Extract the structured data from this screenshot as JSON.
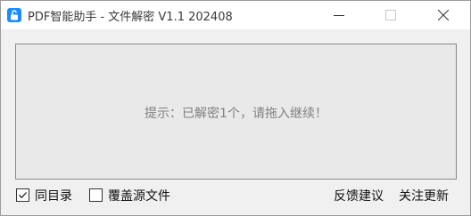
{
  "window": {
    "title": "PDF智能助手 - 文件解密 V1.1 202408",
    "icon": "unlock-icon"
  },
  "controls": {
    "minimize_icon": "minimize-icon",
    "maximize_icon": "maximize-icon",
    "close_icon": "close-icon"
  },
  "drop_zone": {
    "hint": "提示：已解密1个，请拖入继续！"
  },
  "options": {
    "same_directory": {
      "label": "同目录",
      "checked": true
    },
    "overwrite_source": {
      "label": "覆盖源文件",
      "checked": false
    }
  },
  "links": {
    "feedback": "反馈建议",
    "follow_updates": "关注更新"
  },
  "colors": {
    "accent": "#1a8cff",
    "window_bg": "#f0f0f0",
    "drop_zone_bg": "#e9e9e9",
    "hint_text": "#808080"
  }
}
